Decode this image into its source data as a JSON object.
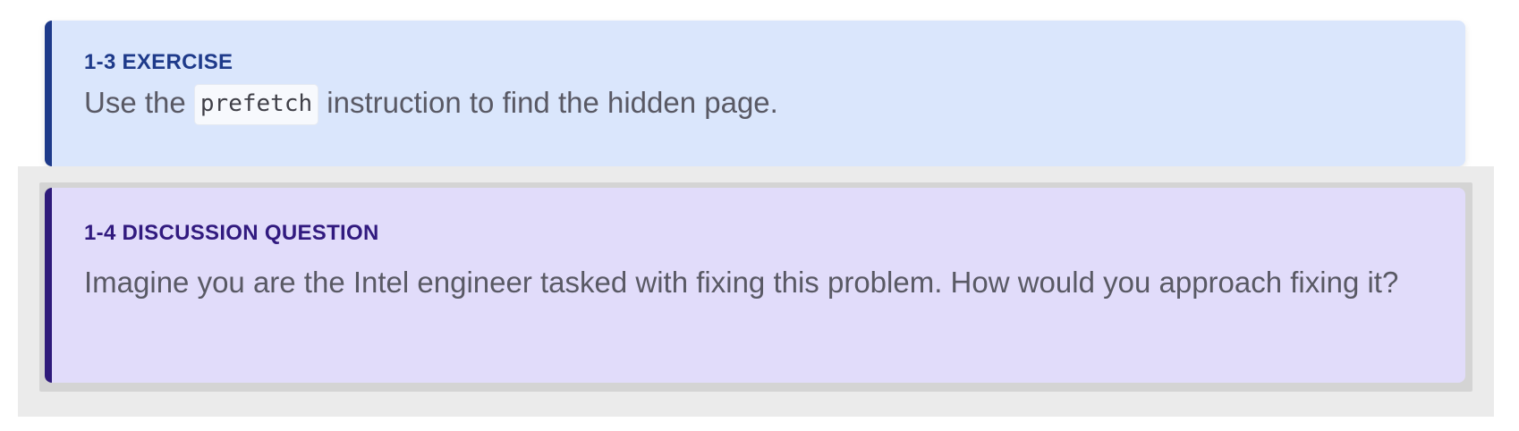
{
  "exercise": {
    "title": "1-3 EXERCISE",
    "text_before": "Use the ",
    "code": "prefetch",
    "text_after": " instruction to find the hidden page."
  },
  "discussion": {
    "title": "1-4 DISCUSSION QUESTION",
    "body": "Imagine you are the Intel engineer tasked with fixing this problem. How would you approach fixing it?"
  },
  "colors": {
    "exercise_bg": "#dae6fc",
    "exercise_accent": "#1e3a8a",
    "discussion_bg": "#e1dcfa",
    "discussion_accent": "#2e1a7a",
    "body_text": "#595964"
  }
}
